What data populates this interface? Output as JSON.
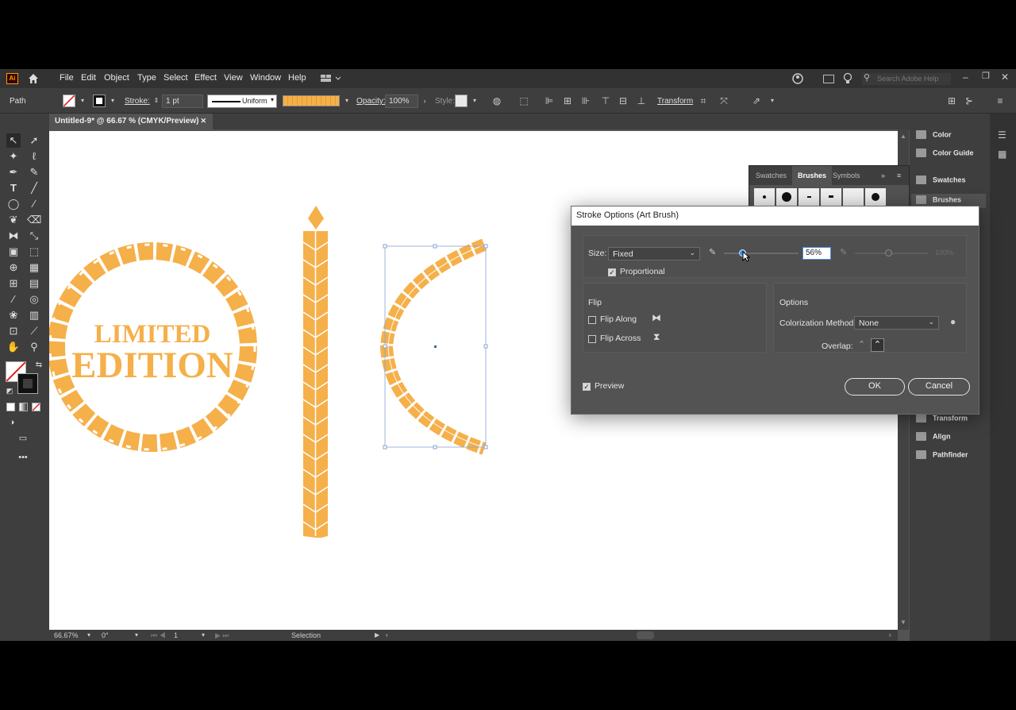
{
  "app": {
    "logo": "Ai",
    "menus": [
      "File",
      "Edit",
      "Object",
      "Type",
      "Select",
      "Effect",
      "View",
      "Window",
      "Help"
    ],
    "search_placeholder": "Search Adobe Help"
  },
  "control_bar": {
    "selection_label": "Path",
    "stroke_label": "Stroke:",
    "stroke_weight": "1 pt",
    "profile": "Uniform",
    "opacity_label": "Opacity:",
    "opacity_value": "100%",
    "style_label": "Style:",
    "transform_label": "Transform"
  },
  "document_tab": {
    "title": "Untitled-9* @ 66.67 % (CMYK/Preview)",
    "close": "✕"
  },
  "artwork": {
    "line1": "LIMITED",
    "line2": "EDITION",
    "color": "#f5b04a"
  },
  "status_bar": {
    "zoom": "66.67%",
    "rotation": "0°",
    "artboard": "1",
    "tool": "Selection"
  },
  "brushes_panel": {
    "tabs": [
      "Swatches",
      "Brushes",
      "Symbols"
    ],
    "active_tab": "Brushes"
  },
  "right_dock": {
    "items_top": [
      "Color",
      "Color Guide",
      "Swatches",
      "Brushes"
    ],
    "items_bottom": [
      "Transform",
      "Align",
      "Pathfinder"
    ]
  },
  "dialog": {
    "title": "Stroke Options (Art Brush)",
    "size_label": "Size:",
    "size_mode": "Fixed",
    "size_value": "56%",
    "size_max": "100%",
    "proportional_label": "Proportional",
    "proportional_checked": true,
    "flip_heading": "Flip",
    "flip_along_label": "Flip Along",
    "flip_along_checked": false,
    "flip_across_label": "Flip Across",
    "flip_across_checked": false,
    "options_heading": "Options",
    "colorization_label": "Colorization Method:",
    "colorization_value": "None",
    "overlap_label": "Overlap:",
    "preview_label": "Preview",
    "preview_checked": true,
    "ok_label": "OK",
    "cancel_label": "Cancel"
  }
}
